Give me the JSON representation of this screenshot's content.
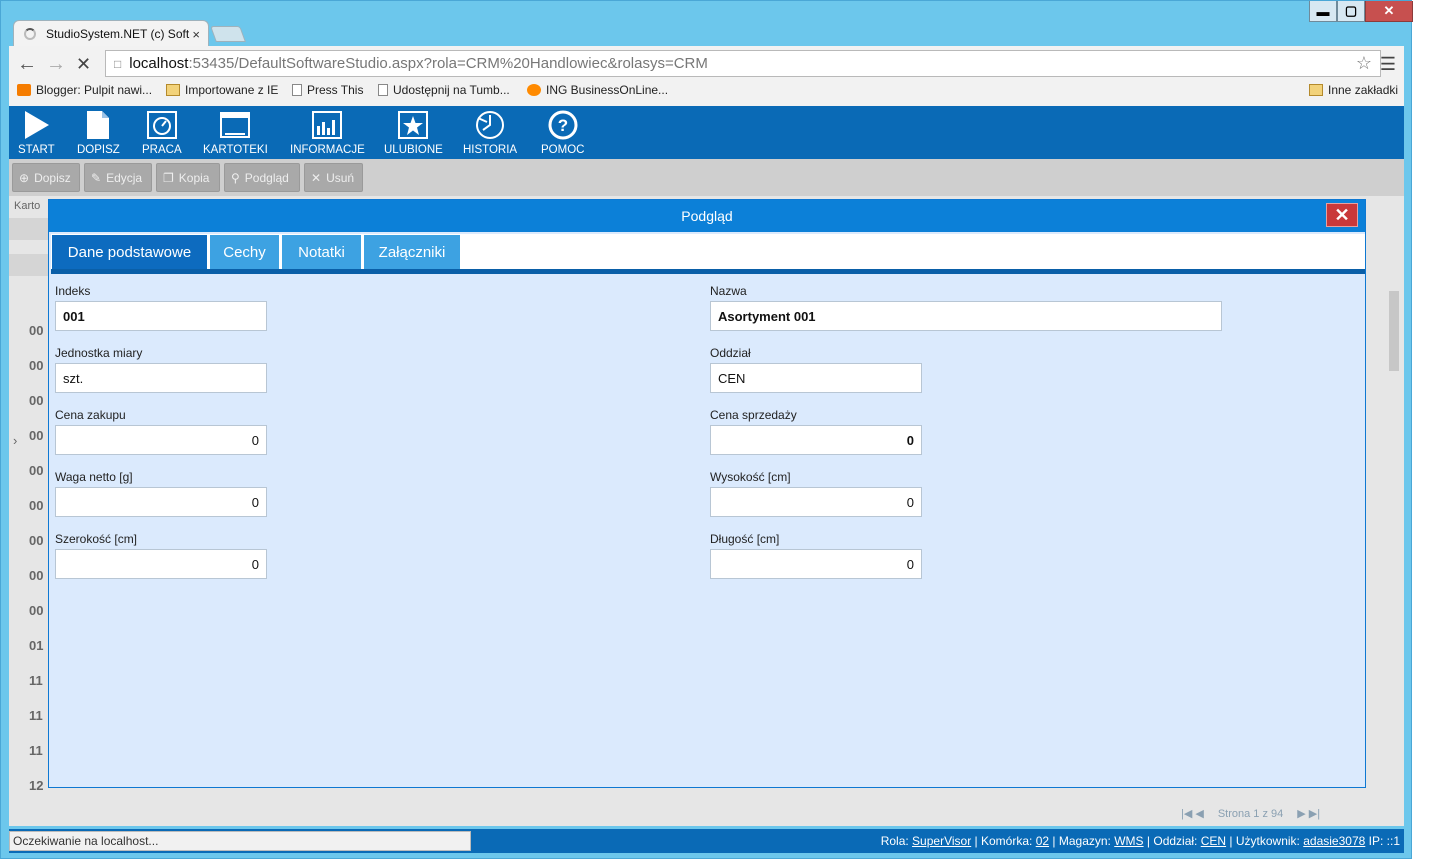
{
  "browser": {
    "tab_title": "StudioSystem.NET (c) Soft",
    "tab_close": "×",
    "url_host": "localhost",
    "url_rest": ":53435/DefaultSoftwareStudio.aspx?rola=CRM%20Handlowiec&rolasys=CRM",
    "window_controls": [
      "▬",
      "▢",
      "✕"
    ],
    "bookmarks": [
      {
        "label": "Blogger: Pulpit nawi...",
        "icon": "blogger-icon"
      },
      {
        "label": "Importowane z IE",
        "icon": "folder-icon"
      },
      {
        "label": "Press This",
        "icon": "page-icon"
      },
      {
        "label": "Udostępnij na Tumb...",
        "icon": "page-icon"
      },
      {
        "label": "ING BusinessOnLine...",
        "icon": "ing-icon"
      }
    ],
    "other_bookmarks": "Inne zakładki"
  },
  "menu": [
    {
      "label": "START",
      "icon": "play-icon"
    },
    {
      "label": "DOPISZ",
      "icon": "document-icon"
    },
    {
      "label": "PRACA",
      "icon": "gauge-icon"
    },
    {
      "label": "KARTOTEKI",
      "icon": "window-icon"
    },
    {
      "label": "INFORMACJE",
      "icon": "chart-icon"
    },
    {
      "label": "ULUBIONE",
      "icon": "star-icon"
    },
    {
      "label": "HISTORIA",
      "icon": "history-icon"
    },
    {
      "label": "POMOC",
      "icon": "help-icon"
    }
  ],
  "toolbar": [
    "Dopisz",
    "Edycja",
    "Kopia",
    "Podgląd",
    "Usuń"
  ],
  "background": {
    "breadcrumb": "Karto",
    "row_codes": [
      "00",
      "00",
      "00",
      "00",
      "00",
      "00",
      "00",
      "00",
      "00",
      "01",
      "11",
      "11",
      "11",
      "12"
    ],
    "row_marker": "›",
    "pager": "Strona 1 z 94"
  },
  "modal": {
    "title": "Podgląd",
    "close": "✕",
    "tabs": [
      "Dane podstawowe",
      "Cechy",
      "Notatki",
      "Załączniki"
    ],
    "fields": {
      "indeks": {
        "label": "Indeks",
        "value": "001"
      },
      "nazwa": {
        "label": "Nazwa",
        "value": "Asortyment 001"
      },
      "jednostka": {
        "label": "Jednostka miary",
        "value": "szt."
      },
      "oddzial": {
        "label": "Oddział",
        "value": "CEN"
      },
      "cena_zakupu": {
        "label": "Cena zakupu",
        "value": "0"
      },
      "cena_sprzedazy": {
        "label": "Cena sprzedaży",
        "value": "0"
      },
      "waga": {
        "label": "Waga netto [g]",
        "value": "0"
      },
      "wysokosc": {
        "label": "Wysokość [cm]",
        "value": "0"
      },
      "szerokosc": {
        "label": "Szerokość [cm]",
        "value": "0"
      },
      "dlugosc": {
        "label": "Długość [cm]",
        "value": "0"
      }
    }
  },
  "status": {
    "loading": "Oczekiwanie na localhost...",
    "rola_label": "Rola:",
    "rola": "SuperVisor",
    "komorka_label": "Komórka:",
    "komorka": "02",
    "magazyn_label": "Magazyn:",
    "magazyn": "WMS",
    "oddzial_label": "Oddział:",
    "oddzial": "CEN",
    "uzytkownik_label": "Użytkownik:",
    "uzytkownik": "adasie3078",
    "ip_label": "IP:",
    "ip": "::1"
  }
}
